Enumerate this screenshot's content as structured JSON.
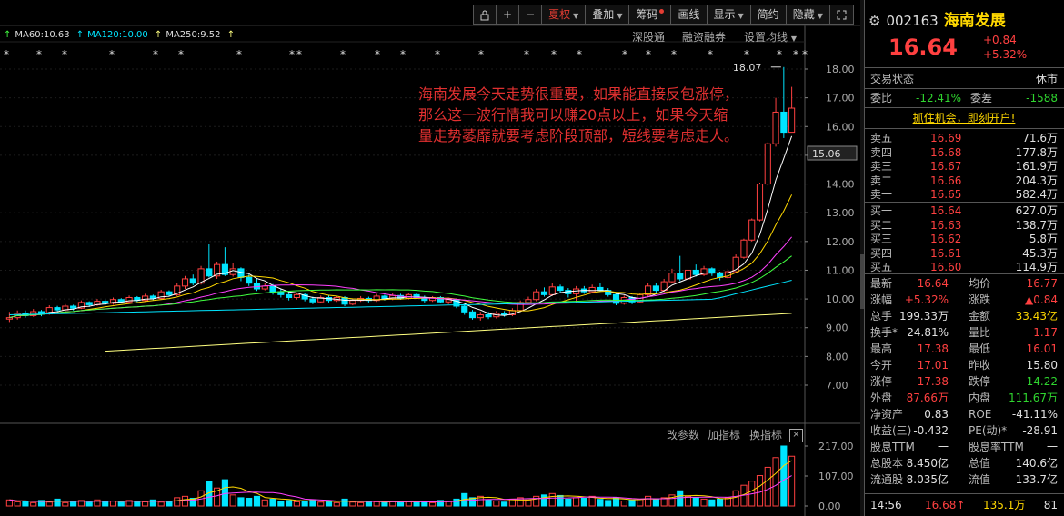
{
  "toolbar": {
    "buttons": [
      {
        "label": "夏权",
        "dropdown": true,
        "active": true
      },
      {
        "label": "叠加",
        "dropdown": true
      },
      {
        "label": "筹码",
        "dot": true
      },
      {
        "label": "画线"
      },
      {
        "label": "显示",
        "dropdown": true
      },
      {
        "label": "简约"
      },
      {
        "label": "隐藏",
        "dropdown": true
      }
    ],
    "icon_plus": "+",
    "icon_minus": "−"
  },
  "ma": {
    "ma60": "MA60:10.63",
    "ma120": "MA120:10.00",
    "ma250": "MA250:9.52",
    "arrow": "↑"
  },
  "sublinks": {
    "a": "深股通",
    "b": "融资融券",
    "c": "设置均线"
  },
  "annotation": "海南发展今天走势很重要，如果能直接反包涨停，那么这一波行情我可以赚20点以上，如果今天缩量走势萎靡就要考虑阶段顶部，短线要考虑走人。",
  "high_marker": "18.07",
  "current_price_tag": "15.06",
  "price_axis": [
    "18.00",
    "17.00",
    "16.00",
    "15.00",
    "14.00",
    "13.00",
    "12.00",
    "11.00",
    "10.00",
    "9.00",
    "8.00",
    "7.00"
  ],
  "volume_tools": {
    "a": "改参数",
    "b": "加指标",
    "c": "换指标",
    "close": "×"
  },
  "volume_axis": [
    "217.00",
    "107.00",
    "0.00"
  ],
  "colors": {
    "up": "#ff4040",
    "down": "#00e5ff",
    "ma5": "#ffffff",
    "ma10": "#ffd800",
    "ma20": "#ff40ff",
    "ma30": "#40ff40",
    "ma60": "#00e5ff",
    "ma250": "#ffff80"
  },
  "stock": {
    "code": "002163",
    "name": "海南发展",
    "price": "16.64",
    "change": "+0.84",
    "change_pct": "+5.32%"
  },
  "status": {
    "label": "交易状态",
    "value": "休市"
  },
  "weibi": {
    "label": "委比",
    "value": "-12.41%",
    "label2": "委差",
    "value2": "-1588"
  },
  "promo": "抓住机会，即刻开户!",
  "asks": [
    {
      "label": "卖五",
      "price": "16.69",
      "vol": "71.6万"
    },
    {
      "label": "卖四",
      "price": "16.68",
      "vol": "177.8万"
    },
    {
      "label": "卖三",
      "price": "16.67",
      "vol": "161.9万"
    },
    {
      "label": "卖二",
      "price": "16.66",
      "vol": "204.3万"
    },
    {
      "label": "卖一",
      "price": "16.65",
      "vol": "582.4万"
    }
  ],
  "bids": [
    {
      "label": "买一",
      "price": "16.64",
      "vol": "627.0万"
    },
    {
      "label": "买二",
      "price": "16.63",
      "vol": "138.7万"
    },
    {
      "label": "买三",
      "price": "16.62",
      "vol": "5.8万"
    },
    {
      "label": "买四",
      "price": "16.61",
      "vol": "45.3万"
    },
    {
      "label": "买五",
      "price": "16.60",
      "vol": "114.9万"
    }
  ],
  "stats": [
    {
      "l1": "最新",
      "v1": "16.64",
      "c1": "red",
      "l2": "均价",
      "v2": "16.77",
      "c2": "red"
    },
    {
      "l1": "涨幅",
      "v1": "+5.32%",
      "c1": "red",
      "l2": "涨跌",
      "v2": "▲0.84",
      "c2": "red"
    },
    {
      "l1": "总手",
      "v1": "199.33万",
      "c1": "white",
      "l2": "金额",
      "v2": "33.43亿",
      "c2": "yellow"
    },
    {
      "l1": "换手*",
      "v1": "24.81%",
      "c1": "white",
      "l2": "量比",
      "v2": "1.17",
      "c2": "red"
    },
    {
      "l1": "最高",
      "v1": "17.38",
      "c1": "red",
      "l2": "最低",
      "v2": "16.01",
      "c2": "red"
    },
    {
      "l1": "今开",
      "v1": "17.01",
      "c1": "red",
      "l2": "昨收",
      "v2": "15.80",
      "c2": "white"
    },
    {
      "l1": "涨停",
      "v1": "17.38",
      "c1": "red",
      "l2": "跌停",
      "v2": "14.22",
      "c2": "green"
    },
    {
      "l1": "外盘",
      "v1": "87.66万",
      "c1": "red",
      "l2": "内盘",
      "v2": "111.67万",
      "c2": "green"
    },
    {
      "l1": "净资产",
      "v1": "0.83",
      "c1": "white",
      "l2": "ROE",
      "v2": "-41.11%",
      "c2": "white"
    },
    {
      "l1": "收益(三)",
      "v1": "-0.432",
      "c1": "white",
      "l2": "PE(动)*",
      "v2": "-28.91",
      "c2": "white"
    },
    {
      "l1": "股息TTM",
      "v1": "一",
      "c1": "white",
      "l2": "股息率TTM",
      "v2": "一",
      "c2": "white"
    },
    {
      "l1": "总股本",
      "v1": "8.450亿",
      "c1": "white",
      "l2": "总值",
      "v2": "140.6亿",
      "c2": "white"
    },
    {
      "l1": "流通股",
      "v1": "8.035亿",
      "c1": "white",
      "l2": "流值",
      "v2": "133.7亿",
      "c2": "white"
    }
  ],
  "tick": {
    "time": "14:56",
    "price": "16.68",
    "arrow": "↑",
    "vol": "135.1万",
    "num": "81"
  }
}
